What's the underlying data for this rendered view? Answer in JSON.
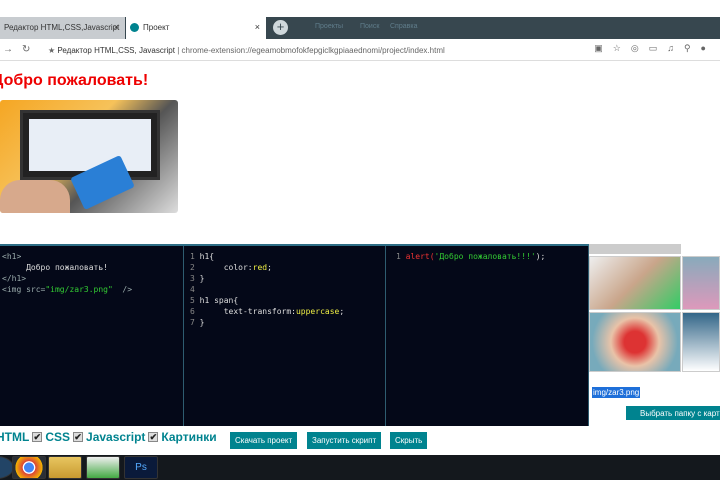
{
  "browser": {
    "tabs": [
      {
        "label": "Редактор HTML,CSS,Javascript"
      },
      {
        "label": "Проект"
      }
    ],
    "bookmarks": [
      "Проекты",
      "Поиск",
      "Справка"
    ],
    "page_title": "Редактор HTML,CSS, Javascript",
    "url": "chrome-extension://egeamobmofokfepgiclkgpiaaednomi/project/index.html"
  },
  "page": {
    "heading": "Добро пожаловать!"
  },
  "editor": {
    "html": {
      "l1": "<h1>",
      "l2": "     Добро пожаловать!",
      "l3": "</h1>",
      "l4a": "<img src=",
      "l4b": "\"img/zar3.png\"",
      "l4c": "  />"
    },
    "css": {
      "n1": "1",
      "c1": " h1{",
      "n2": "2",
      "c2a": "      color:",
      "c2b": "red",
      "c2c": ";",
      "n3": "3",
      "c3": " }",
      "n4": "4",
      "n5": "5",
      "c5": " h1 span{",
      "n6": "6",
      "c6a": "      text-transform:",
      "c6b": "uppercase",
      "c6c": ";",
      "n7": "7",
      "c7": " }"
    },
    "js": {
      "n1": "1",
      "fn": " alert(",
      "str": "'Добро пожаловать!!!'",
      "end": ");"
    }
  },
  "images": {
    "selected_path": "img/zar3.png",
    "folder_button": "Выбрать папку с картинками"
  },
  "controls": {
    "html": "HTML",
    "css": "CSS",
    "js": "Javascript",
    "pics": "Картинки",
    "download": "Скачать проект",
    "run": "Запустить скрипт",
    "hide": "Скрыть"
  },
  "taskbar": {
    "ps": "Ps"
  }
}
